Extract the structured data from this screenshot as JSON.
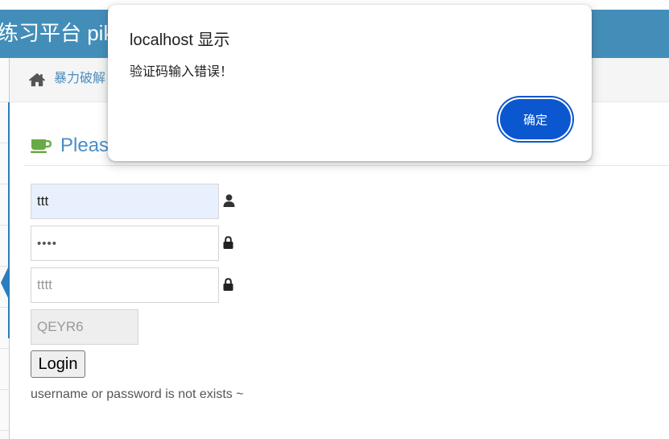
{
  "colors": {
    "header": "#438EB9",
    "link": "#4C8FBD",
    "heading": "#478FCA",
    "dialog_button": "#0B57D0",
    "coffee_icon": "#69AA46",
    "autofill": "#E8F0FE"
  },
  "header": {
    "title": "练习平台 pik"
  },
  "breadcrumb": {
    "icon": "home-icon",
    "item": "暴力破解"
  },
  "main": {
    "heading": {
      "icon": "coffee-icon",
      "text": "Pleas"
    },
    "form": {
      "username": {
        "value": "ttt",
        "icon": "user-icon"
      },
      "password": {
        "value": "••••",
        "icon": "lock-icon"
      },
      "vcode": {
        "value": "tttt",
        "icon": "lock-icon"
      },
      "captcha": {
        "value": "QEYR6"
      },
      "submit_label": "Login"
    },
    "status_message": "username or password is not exists ~"
  },
  "dialog": {
    "title": "localhost 显示",
    "message": "验证码输入错误！",
    "ok_label": "确定"
  }
}
